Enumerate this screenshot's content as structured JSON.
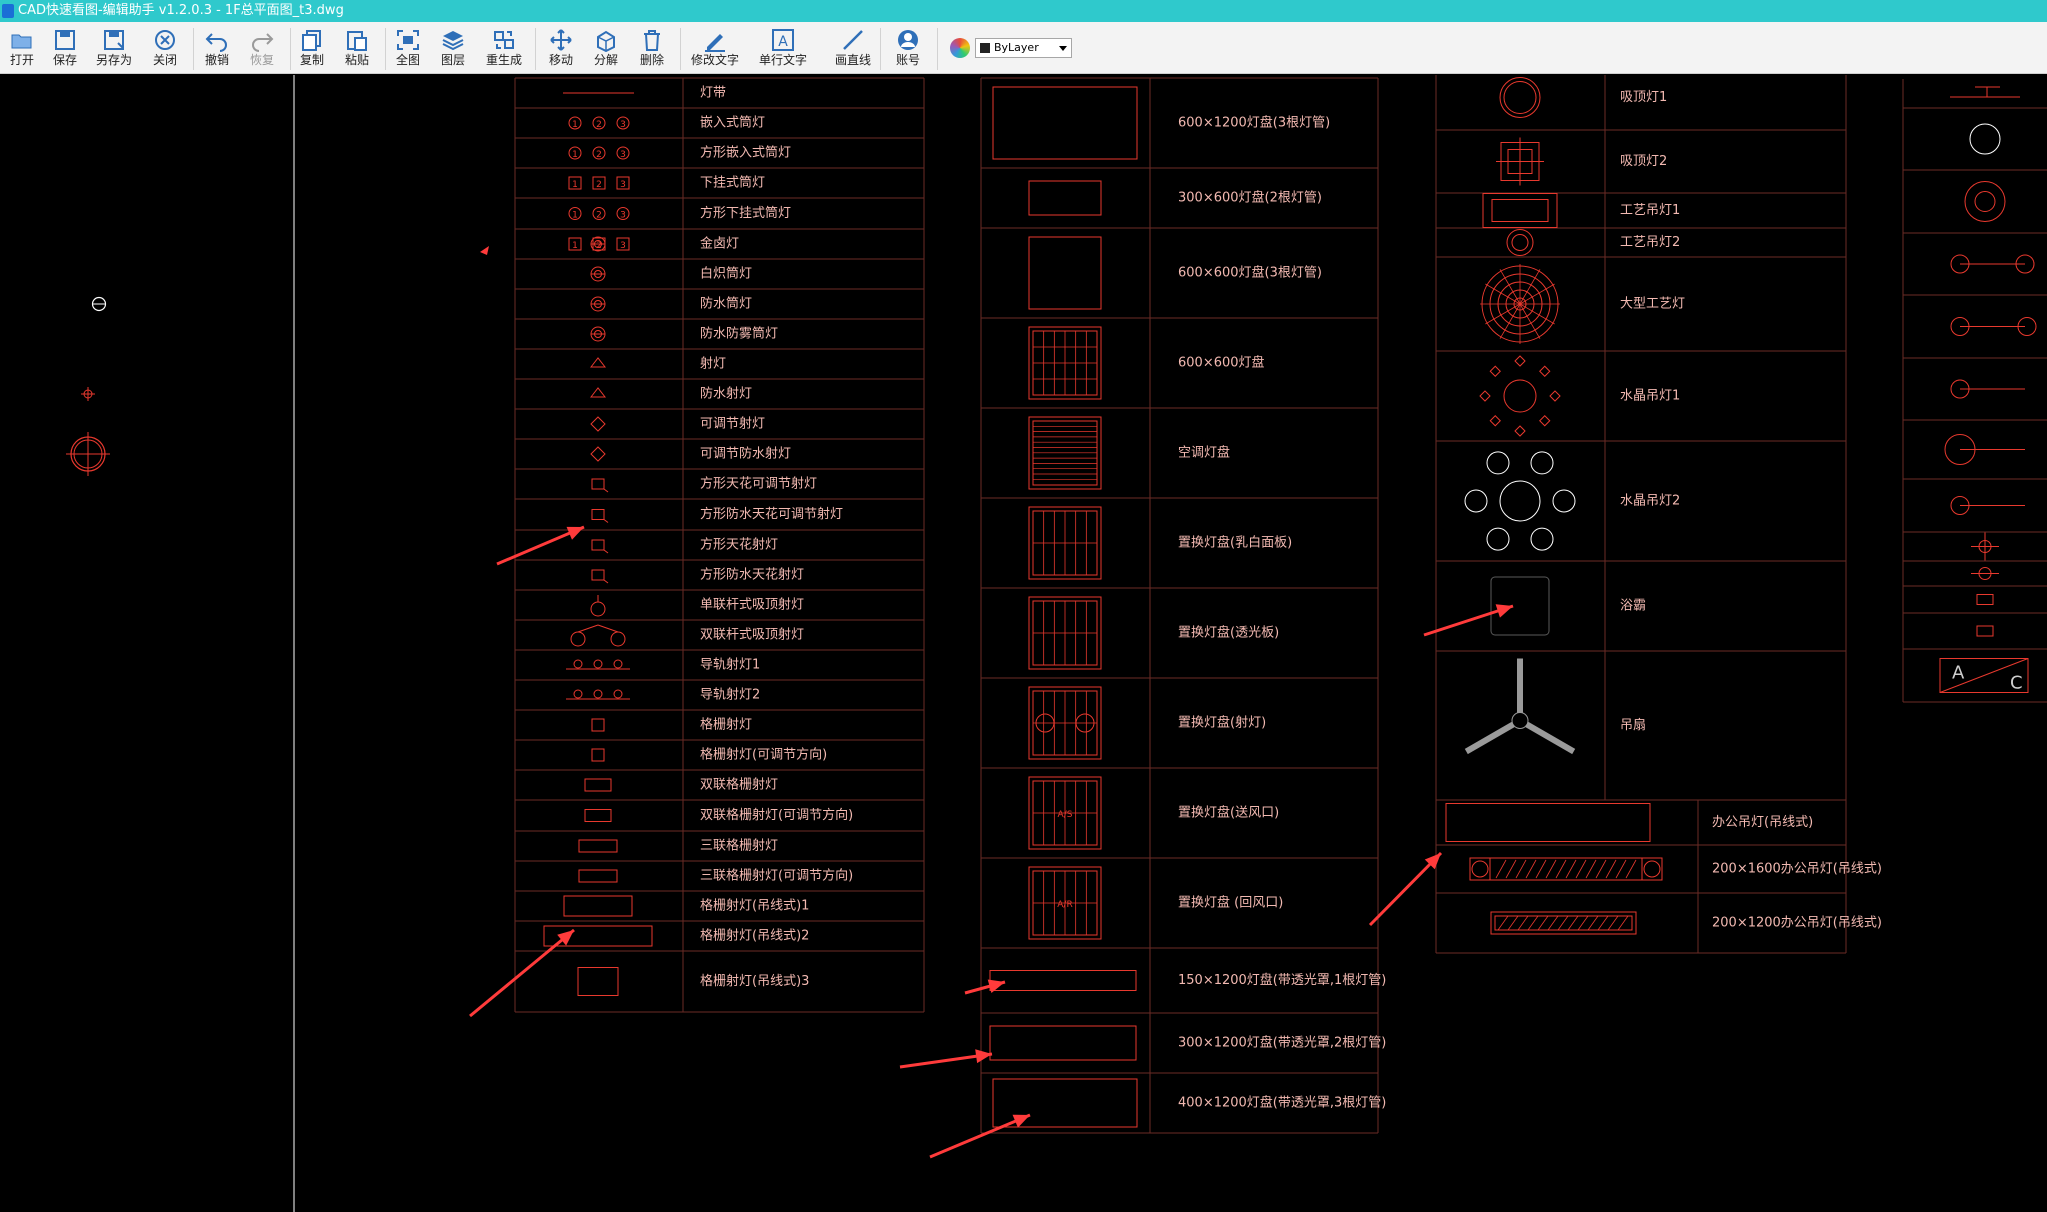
{
  "window": {
    "title": "CAD快速看图-编辑助手 v1.2.0.3 - 1F总平面图_t3.dwg"
  },
  "toolbar": {
    "open": "打开",
    "save": "保存",
    "save_as": "另存为",
    "close": "关闭",
    "undo": "撤销",
    "redo": "恢复",
    "copy": "复制",
    "paste": "粘贴",
    "fit_all": "全图",
    "layers": "图层",
    "regenerate": "重生成",
    "move": "移动",
    "explode": "分解",
    "delete": "删除",
    "edit_text": "修改文字",
    "single_text": "单行文字",
    "draw_line": "画直线",
    "account": "账号",
    "layer_value": "ByLayer"
  },
  "legend": {
    "col1": [
      "灯带",
      "嵌入式筒灯",
      "方形嵌入式筒灯",
      "下挂式筒灯",
      "方形下挂式筒灯",
      "金卤灯",
      "白炽筒灯",
      "防水筒灯",
      "防水防雾筒灯",
      "射灯",
      "防水射灯",
      "可调节射灯",
      "可调节防水射灯",
      "方形天花可调节射灯",
      "方形防水天花可调节射灯",
      "方形天花射灯",
      "方形防水天花射灯",
      "单联杆式吸顶射灯",
      "双联杆式吸顶射灯",
      "导轨射灯1",
      "导轨射灯2",
      "格栅射灯",
      "格栅射灯(可调节方向)",
      "双联格栅射灯",
      "双联格栅射灯(可调节方向)",
      "三联格栅射灯",
      "三联格栅射灯(可调节方向)",
      "格栅射灯(吊线式)1",
      "格栅射灯(吊线式)2",
      "格栅射灯(吊线式)3"
    ],
    "col2": [
      "600×1200灯盘(3根灯管)",
      "300×600灯盘(2根灯管)",
      "600×600灯盘(3根灯管)",
      "600×600灯盘",
      "空调灯盘",
      "置换灯盘(乳白面板)",
      "置换灯盘(透光板)",
      "置换灯盘(射灯)",
      "置换灯盘(送风口)",
      "置换灯盘 (回风口)",
      "150×1200灯盘(带透光罩,1根灯管)",
      "300×1200灯盘(带透光罩,2根灯管)",
      "400×1200灯盘(带透光罩,3根灯管)"
    ],
    "col3": [
      "吸顶灯1",
      "吸顶灯2",
      "工艺吊灯1",
      "工艺吊灯2",
      "大型工艺灯",
      "水晶吊灯1",
      "水晶吊灯2",
      "浴霸",
      "吊扇",
      "办公吊灯(吊线式)",
      "200×1600办公吊灯(吊线式)",
      "200×1200办公吊灯(吊线式)"
    ],
    "col4_text": {
      "a": "A",
      "c": "C"
    },
    "panel_labels": {
      "a_s": "A/S",
      "a_r": "A/R"
    }
  },
  "colors": {
    "cad_red": "#e8392e",
    "cad_text": "#f2b9b1",
    "cad_white": "#ffffff",
    "grid": "#6b2b26",
    "titlebar": "#2fc9cc",
    "arrow": "#ff3b3b"
  },
  "icons": [
    "open-icon",
    "save-icon",
    "save-as-icon",
    "close-icon",
    "undo-icon",
    "redo-icon",
    "copy-icon",
    "paste-icon",
    "fit-all-icon",
    "layers-icon",
    "regenerate-icon",
    "move-icon",
    "explode-icon",
    "delete-icon",
    "edit-text-icon",
    "single-text-icon",
    "draw-line-icon",
    "account-icon"
  ]
}
